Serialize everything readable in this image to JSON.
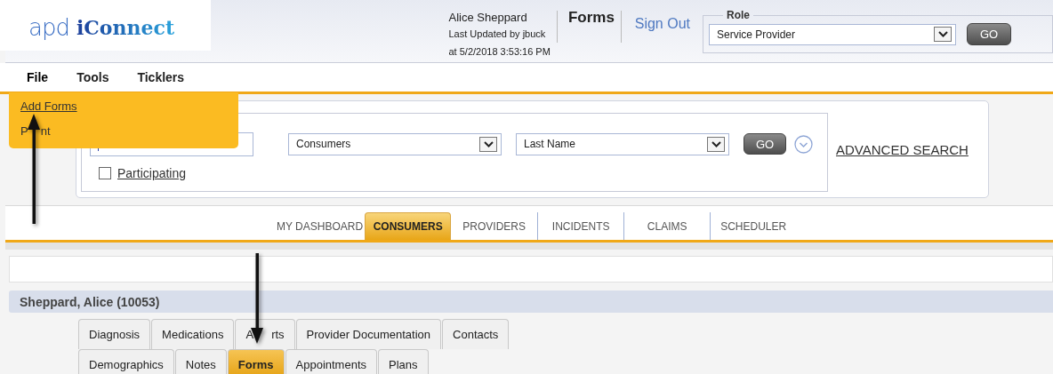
{
  "header": {
    "logo": {
      "part_1": "apd",
      "part_2": "iConnect"
    },
    "user_name": "Alice Sheppard",
    "last_updated": "Last Updated by jbuck",
    "updated_at": "at 5/2/2018 3:53:16 PM",
    "page_title": "Forms",
    "sign_out": "Sign Out",
    "role": {
      "legend": "Role",
      "value": "Service Provider",
      "button": "GO"
    }
  },
  "menu_bar": [
    {
      "label": "File",
      "expanded": true
    },
    {
      "label": "Tools",
      "expanded": false
    },
    {
      "label": "Ticklers",
      "expanded": false
    }
  ],
  "file_menu": {
    "items": [
      {
        "label_parts": [
          "Add Forms"
        ]
      },
      {
        "label_parts": [
          "P",
          "nt"
        ]
      }
    ]
  },
  "search": {
    "search_in": "Consumers",
    "search_by": "Last Name",
    "button": "GO",
    "participating": {
      "label": "Participating",
      "checked": false
    },
    "advanced_search": "ADVANCED SEARCH"
  },
  "nav_tabs": [
    {
      "label": "MY DASHBOARD",
      "selected": false
    },
    {
      "label": "CONSUMERS",
      "selected": true
    },
    {
      "label": "PROVIDERS",
      "selected": false
    },
    {
      "label": "INCIDENTS",
      "selected": false
    },
    {
      "label": "CLAIMS",
      "selected": false
    },
    {
      "label": "SCHEDULER",
      "selected": false
    }
  ],
  "consumer_header": "Sheppard, Alice (10053)",
  "record_tab_rows": [
    {
      "tabs": [
        {
          "label": "Diagnosis",
          "selected": false
        },
        {
          "label": "Medications",
          "selected": false
        },
        {
          "label_parts": [
            "A",
            "rts"
          ],
          "selected": false
        },
        {
          "label": "Provider Documentation",
          "selected": false
        },
        {
          "label": "Contacts",
          "selected": false
        }
      ]
    },
    {
      "tabs": [
        {
          "label": "Demographics",
          "selected": false
        },
        {
          "label": "Notes",
          "selected": false
        },
        {
          "label": "Forms",
          "selected": true
        },
        {
          "label": "Appointments",
          "selected": false
        },
        {
          "label": "Plans",
          "selected": false
        }
      ]
    }
  ]
}
